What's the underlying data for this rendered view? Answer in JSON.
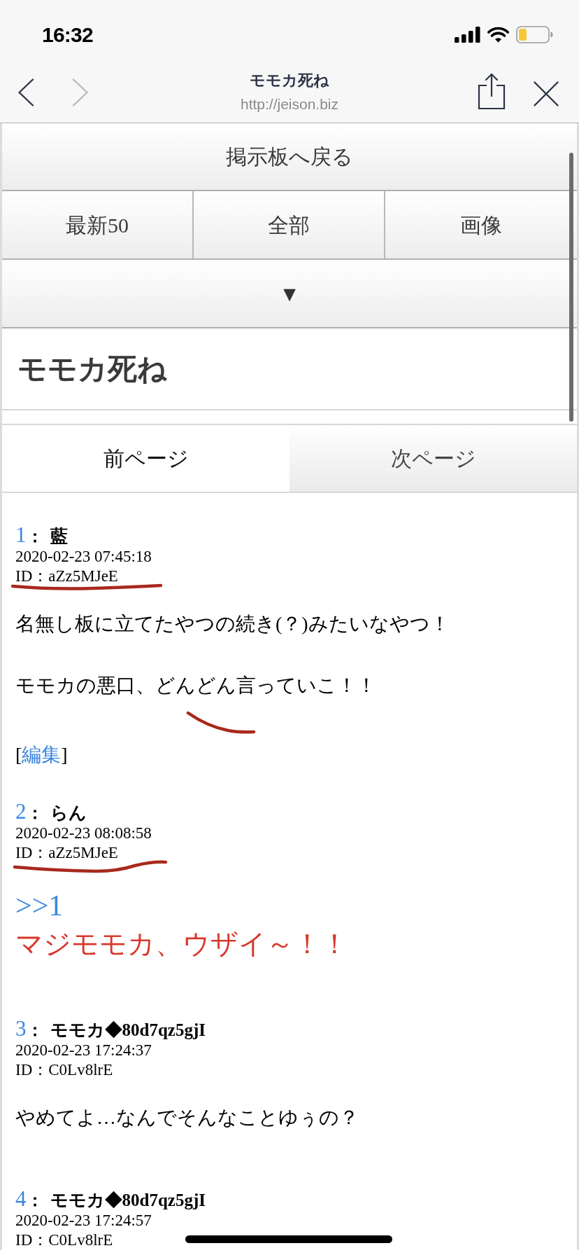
{
  "status_bar": {
    "time": "16:32"
  },
  "browser_bar": {
    "title": "モモカ死ね",
    "url": "http://jeison.biz",
    "nav": [
      {
        "kind": "back",
        "disabled": false
      },
      {
        "kind": "forward",
        "disabled": true
      }
    ]
  },
  "board_button": "掲示板へ戻る",
  "view_buttons": [
    "最新50",
    "全部",
    "画像"
  ],
  "expand_button": "▼",
  "thread_title": "モモカ死ね",
  "page_tabs": [
    {
      "label": "前ページ",
      "selected": true
    },
    {
      "label": "次ページ",
      "selected": false
    }
  ],
  "posts": [
    {
      "number": "1",
      "separator": "：",
      "name": "藍",
      "date": "2020-02-23 07:45:18",
      "id": "ID：aZz5MJeE",
      "body": [
        {
          "kind": "text",
          "text": "名無し板に立てたやつの続き(？)みたいなやつ！"
        },
        {
          "kind": "text",
          "text": "モモカの悪口、どんどん言っていこ！！"
        }
      ],
      "edit": {
        "before": "[",
        "link": "編集",
        "after": "]"
      }
    },
    {
      "number": "2",
      "separator": "：",
      "name": "らん",
      "date": "2020-02-23 08:08:58",
      "id": "ID：aZz5MJeE",
      "body": [
        {
          "kind": "reply",
          "text": ">>1"
        },
        {
          "kind": "emphasis",
          "text": "マジモモカ、ウザイ～！！"
        }
      ]
    },
    {
      "number": "3",
      "separator": "：",
      "name": "モモカ◆80d7qz5gjI",
      "date": "2020-02-23 17:24:37",
      "id": "ID：C0Lv8lrE",
      "body": [
        {
          "kind": "text",
          "text": "やめてよ…なんでそんなことゆぅの？"
        }
      ]
    },
    {
      "number": "4",
      "separator": "：",
      "name": "モモカ◆80d7qz5gjI",
      "date": "2020-02-23 17:24:57",
      "id": "ID：C0Lv8lrE"
    }
  ]
}
